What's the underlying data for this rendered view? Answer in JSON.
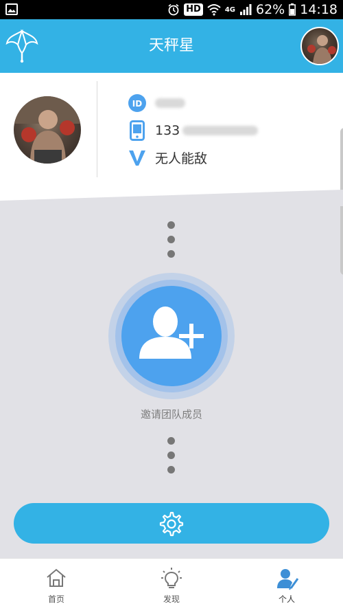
{
  "status_bar": {
    "network_badge": "HD",
    "network_type": "4G",
    "battery": "62%",
    "time": "14:18",
    "icons": [
      "gallery-icon",
      "alarm-icon",
      "wifi-icon",
      "signal-icon",
      "battery-icon"
    ]
  },
  "header": {
    "title": "天秤星",
    "logo_icon": "umbrella-logo-icon",
    "avatar": "user-avatar"
  },
  "profile": {
    "id_value": "",
    "phone_prefix": "133",
    "phone_masked": "",
    "role": "无人能敌",
    "icons": [
      "id-icon",
      "phone-icon",
      "v-icon"
    ]
  },
  "main": {
    "invite_label": "邀请团队成员",
    "invite_icon": "add-user-icon",
    "settings_icon": "gear-icon"
  },
  "bottom_nav": {
    "items": [
      {
        "label": "首页",
        "icon": "home-icon",
        "active": false
      },
      {
        "label": "发现",
        "icon": "bulb-icon",
        "active": false
      },
      {
        "label": "个人",
        "icon": "person-icon",
        "active": true
      }
    ]
  },
  "colors": {
    "primary": "#33b2e5",
    "invite_blue": "#4da2ee",
    "background": "#e1e1e6",
    "text_dark": "#333333",
    "text_muted": "#7d7d7d"
  }
}
